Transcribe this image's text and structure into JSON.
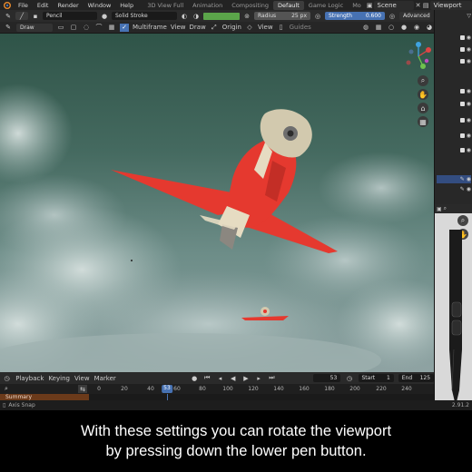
{
  "menus": [
    "File",
    "Edit",
    "Render",
    "Window",
    "Help"
  ],
  "workspaces": [
    {
      "label": "3D View Full",
      "active": false
    },
    {
      "label": "Animation",
      "active": false
    },
    {
      "label": "Compositing",
      "active": false
    },
    {
      "label": "Default",
      "active": true
    },
    {
      "label": "Game Logic",
      "active": false
    },
    {
      "label": "Mo",
      "active": false
    }
  ],
  "scene_label": "Scene",
  "viewlayer_label": "Viewport",
  "toolsettings": {
    "brush": "Pencil",
    "stroke": "Solid Stroke",
    "radius_label": "Radius",
    "radius_value": "25 px",
    "strength_label": "Strength",
    "strength_value": "0.600",
    "advanced": "Advanced"
  },
  "header": {
    "mode": "Draw",
    "multiframe": "Multiframe",
    "view": "View",
    "draw": "Draw",
    "origin": "Origin",
    "view2": "View",
    "guides": "Guides"
  },
  "timeline": {
    "playback": "Playback",
    "keying": "Keying",
    "view": "View",
    "marker": "Marker",
    "current_frame": "53",
    "start_label": "Start",
    "start_value": "1",
    "end_label": "End",
    "end_value": "125",
    "ticks": [
      "0",
      "20",
      "40",
      "53",
      "60",
      "80",
      "100",
      "120",
      "140",
      "160",
      "180",
      "200",
      "220",
      "240"
    ],
    "summary": "Summary"
  },
  "status": {
    "left": "Axis Snap",
    "right": "2.91.2"
  },
  "caption": {
    "line1": "With these settings you can rotate the viewport",
    "line2": "by pressing down the lower pen button."
  },
  "colors": {
    "accent": "#4772b3",
    "plane_red": "#e5392f",
    "plane_cream": "#e6dcc2",
    "sky": "#456a60"
  }
}
